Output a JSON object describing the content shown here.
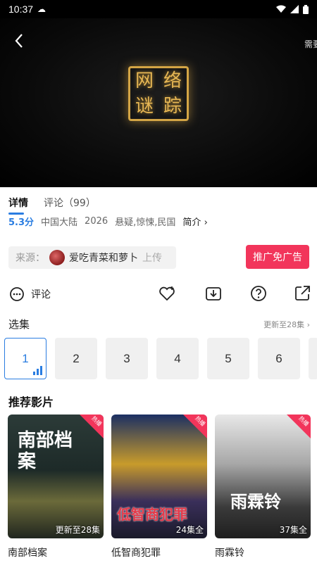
{
  "status_bar": {
    "time": "10:37"
  },
  "player": {
    "edge_text": "需要",
    "logo_chars": [
      "网",
      "络",
      "谜",
      "踪"
    ]
  },
  "tabs": [
    {
      "label": "详情",
      "active": true
    },
    {
      "label": "评论（99）",
      "active": false
    }
  ],
  "meta": {
    "score": "5.3分",
    "region": "中国大陆",
    "year": "2026",
    "genres": "悬疑,惊悚,民国",
    "intro_label": "简介"
  },
  "source": {
    "label": "来源：",
    "uploader": "爱吃青菜和萝卜",
    "suffix": "上传"
  },
  "ad_button": "推广免广告",
  "actions": {
    "comment_label": "评论"
  },
  "episodes": {
    "title": "选集",
    "update_text": "更新至28集",
    "items": [
      "1",
      "2",
      "3",
      "4",
      "5",
      "6"
    ],
    "selected": "1"
  },
  "recommend": {
    "title": "推荐影片",
    "items": [
      {
        "name": "南部档案",
        "status": "更新至28集",
        "badge": "热播",
        "poster_text": "南部档案"
      },
      {
        "name": "低智商犯罪",
        "status": "24集全",
        "badge": "热播",
        "poster_text": "低智商犯罪"
      },
      {
        "name": "雨霖铃",
        "status": "37集全",
        "badge": "热播",
        "poster_text": "雨霖铃"
      }
    ]
  },
  "colors": {
    "accent": "#2a7de1",
    "ad_red": "#f2355b",
    "logo_gold": "#d4a545"
  }
}
